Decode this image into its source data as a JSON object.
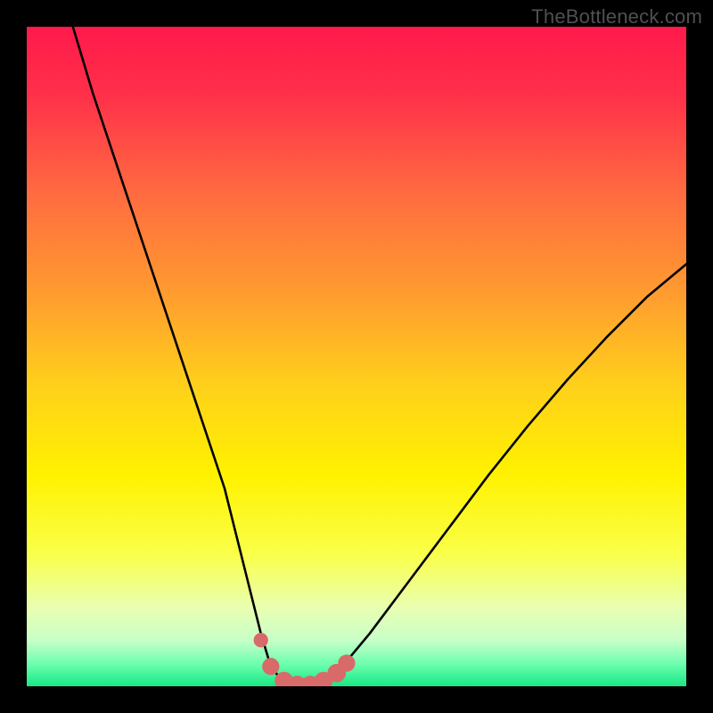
{
  "watermark": "TheBottleneck.com",
  "colors": {
    "frame": "#000000",
    "curve": "#000000",
    "marker": "#d86a6a",
    "gradient_stops": [
      {
        "offset": 0.0,
        "color": "#ff1a4b"
      },
      {
        "offset": 0.1,
        "color": "#ff2f4a"
      },
      {
        "offset": 0.25,
        "color": "#ff6a40"
      },
      {
        "offset": 0.4,
        "color": "#ff9a30"
      },
      {
        "offset": 0.55,
        "color": "#ffd21a"
      },
      {
        "offset": 0.68,
        "color": "#fff200"
      },
      {
        "offset": 0.8,
        "color": "#faff4a"
      },
      {
        "offset": 0.88,
        "color": "#e9ffb0"
      },
      {
        "offset": 0.93,
        "color": "#c8ffc8"
      },
      {
        "offset": 0.965,
        "color": "#70ffb0"
      },
      {
        "offset": 1.0,
        "color": "#17e884"
      }
    ]
  },
  "chart_data": {
    "type": "line",
    "title": "",
    "xlabel": "",
    "ylabel": "",
    "xlim": [
      0,
      100
    ],
    "ylim": [
      0,
      100
    ],
    "grid": false,
    "legend": false,
    "series": [
      {
        "name": "bottleneck-curve",
        "x": [
          7,
          10,
          14,
          18,
          22,
          26,
          30,
          32,
          34,
          35.5,
          37,
          39,
          41,
          43,
          45,
          47,
          52,
          58,
          64,
          70,
          76,
          82,
          88,
          94,
          100
        ],
        "y": [
          100,
          90,
          78,
          66,
          54,
          42,
          30,
          22,
          14,
          8,
          3,
          0.5,
          0,
          0,
          0.5,
          2,
          8,
          16,
          24,
          32,
          39.5,
          46.5,
          53,
          59,
          64
        ]
      }
    ],
    "markers": {
      "name": "trough-markers",
      "x": [
        35.5,
        37,
        39,
        41,
        43,
        45,
        47,
        48.5
      ],
      "y": [
        7,
        3,
        0.8,
        0.2,
        0.2,
        0.8,
        2,
        3.5
      ],
      "r": [
        1.1,
        1.3,
        1.4,
        1.4,
        1.4,
        1.4,
        1.4,
        1.3
      ]
    }
  }
}
